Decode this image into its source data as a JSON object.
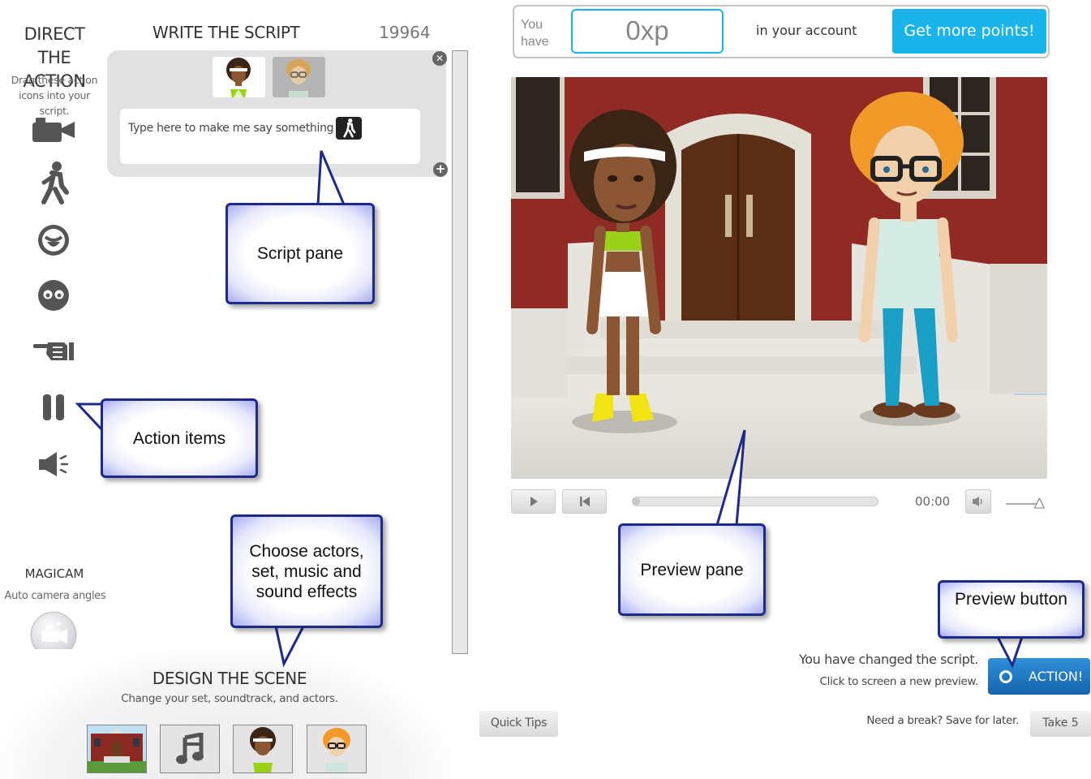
{
  "actions_panel": {
    "title_line1": "DIRECT",
    "title_line2": "THE ACTION",
    "subtitle_line1": "Drag these action",
    "subtitle_line2": "icons into your script.",
    "items": [
      {
        "icon": "video-camera-icon"
      },
      {
        "icon": "walking-person-icon"
      },
      {
        "icon": "smiley-face-icon"
      },
      {
        "icon": "eyes-face-icon"
      },
      {
        "icon": "pointing-hand-icon"
      },
      {
        "icon": "pause-icon"
      },
      {
        "icon": "speaker-icon"
      }
    ],
    "magicam_title": "MAGICAM",
    "magicam_subtitle": "Auto camera angles"
  },
  "script_pane": {
    "title": "WRITE THE SCRIPT",
    "count": "19964",
    "placeholder": "Type here to make me say something"
  },
  "design_scene": {
    "title": "DESIGN THE SCENE",
    "subtitle": "Change your set, soundtrack, and actors.",
    "buttons": [
      {
        "icon": "set-thumbnail"
      },
      {
        "icon": "music-note-icon"
      },
      {
        "icon": "actor-girl-thumbnail"
      },
      {
        "icon": "actor-boy-thumbnail"
      }
    ]
  },
  "points": {
    "you": "You",
    "have": "have",
    "xp": "0xp",
    "in_account": "in your account",
    "get_more": "Get more points!"
  },
  "player": {
    "time": "00:00",
    "progress": 0.02,
    "volume": 0.9
  },
  "preview": {
    "changed": "You have changed the script.",
    "click_new": "Click to screen a new preview.",
    "action_label": "ACTION!"
  },
  "footer": {
    "quick_tips": "Quick Tips",
    "need_break": "Need a break? Save for later.",
    "take5": "Take 5"
  },
  "callouts": {
    "script_pane": "Script pane",
    "action_items": "Action items",
    "choose_line1": "Choose actors,",
    "choose_line2": "set, music and",
    "choose_line3": "sound effects",
    "preview_pane": "Preview pane",
    "preview_button": "Preview button"
  },
  "colors": {
    "accent_blue": "#1ab3ea",
    "action_blue": "#1f77c3",
    "callout_border": "#1d2a8a"
  }
}
